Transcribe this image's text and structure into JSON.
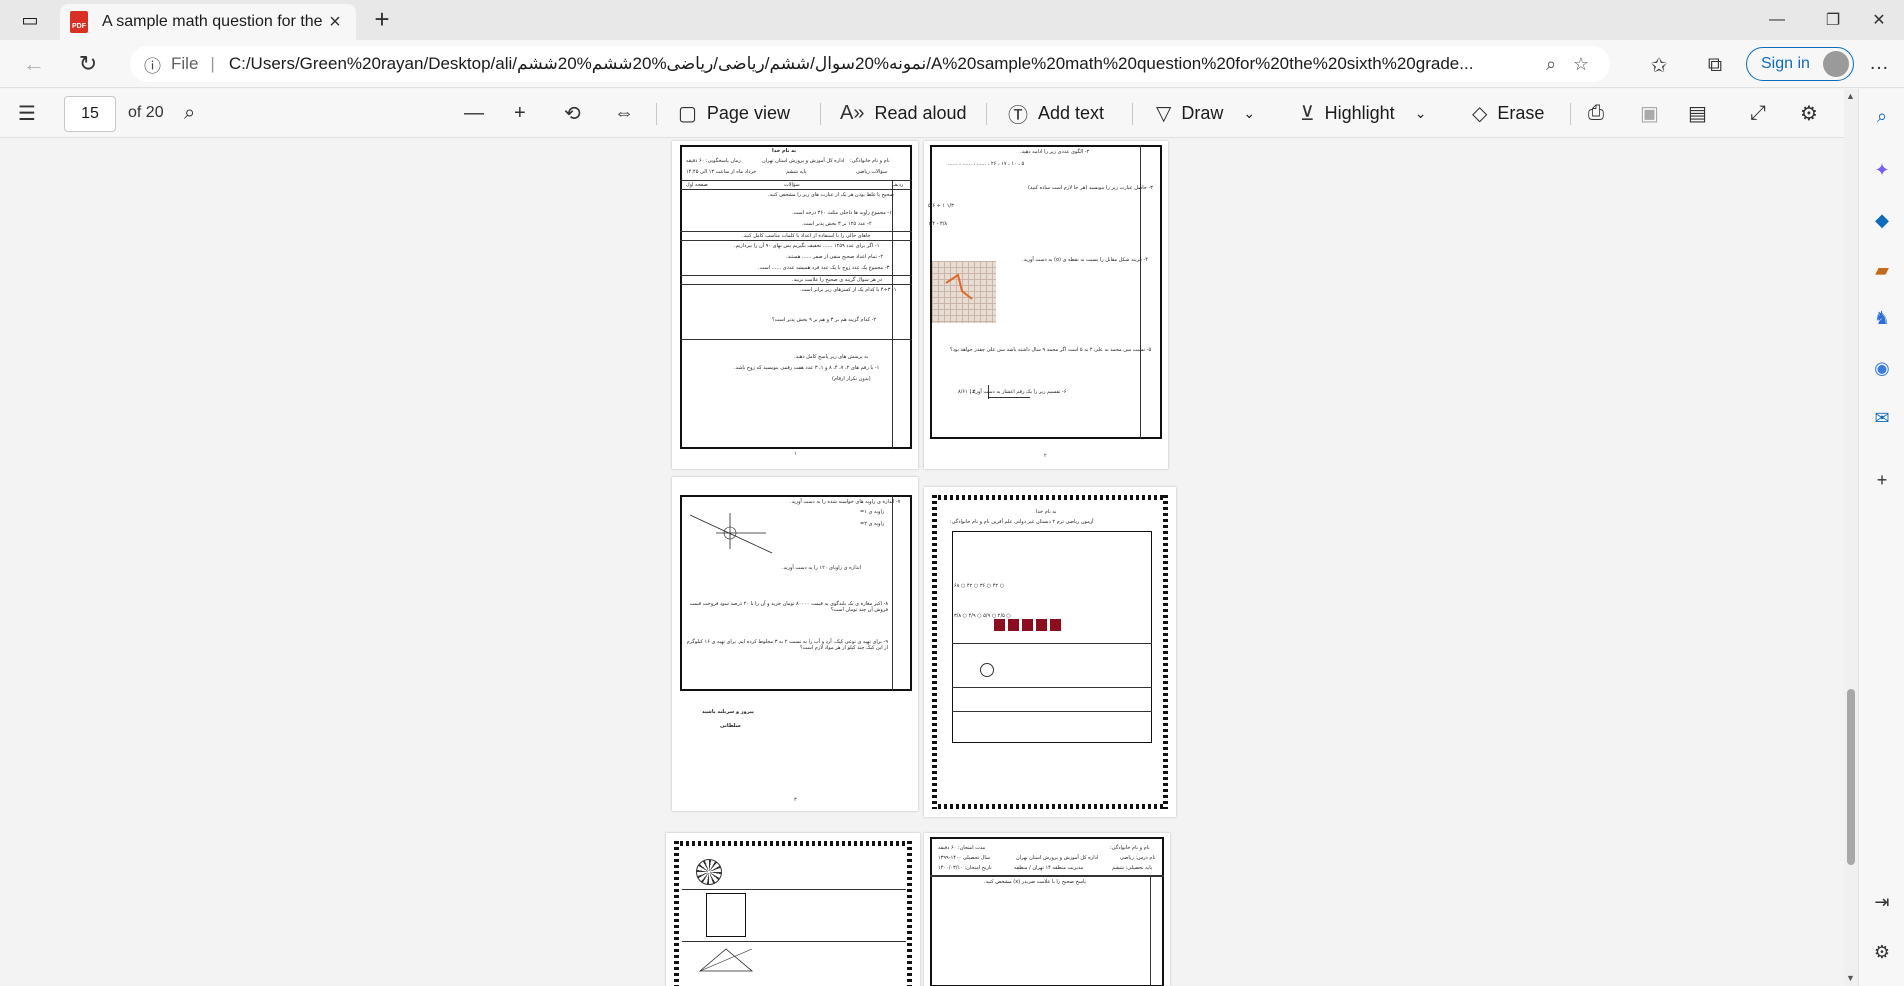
{
  "browser": {
    "tab": {
      "title": "A sample math question for the sixth grade"
    },
    "address": {
      "info_label": "File",
      "url": "C:/Users/Green%20rayan/Desktop/ali/نمونه%20سوال/ششم/ریاضی/ریاضی%20ششم%20ششم/A%20sample%20math%20question%20for%20the%20sixth%20grade..."
    },
    "signin_label": "Sign in"
  },
  "pdf_toolbar": {
    "page_number": "15",
    "page_total": "of 20",
    "page_view_label": "Page view",
    "read_aloud_label": "Read aloud",
    "add_text_label": "Add text",
    "draw_label": "Draw",
    "highlight_label": "Highlight",
    "erase_label": "Erase"
  },
  "pages": {
    "p1": {
      "header_basmala": "به نام خدا",
      "name_label": "نام و نام خانوادگی:",
      "org": "اداره کل آموزش و پرورش استان تهران",
      "duration": "زمان پاسخگویی: ۶۰ دقیقه",
      "subject": "سؤالات ریاضی",
      "grade": "پایه ششم",
      "date": "خرداد ماه از ساعت ۱۳ الی ۱۴:۴۵",
      "col_row": "ردیف",
      "col_questions": "سؤالات",
      "page_label": "صفحه اول",
      "q_a": "صحیح یا غلط بودن هر یک از عبارت های زیر را مشخص کنید.",
      "q_a1": "۱- مجموع زاویه ها داخلی مثلث ۳۶۰ درجه است.",
      "q_a2": "۲- عدد ۱۲۵ بر ۳ بخش پذیر است.",
      "q_b": "جاهای خالی را با استفاده از اعداد یا کلمات مناسب کامل کنید.",
      "q_b1": "۱- اگر برای عدد ۱۲۵۹ ...... تخفیف بگیریم پس بهای ۹۰ آن را بپردازیم.",
      "q_b2": "۲- تمام اعداد صحیح منفی از صفر ...... هستند.",
      "q_b3": "۳- مجموع یک عدد زوج با یک عدد فرد همیشه عددی ...... است.",
      "q_c": "در هر سوال گزینه ی صحیح را علامت بزنید.",
      "q_c1": "۱- ۳÷۴ با کدام یک از کسرهای زیر برابر است.",
      "q_c2": "۲- کدام گزینه هم بر ۳ و هم بر ۹ بخش پذیر است؟",
      "q_d": "به پرسش های زیر پاسخ کامل دهید.",
      "q_d1": "۱- با رقم های ۲، ۷، ۴، ۸ و ۱، ۳ عدد هفت رقمی بنویسید که زوج باشد.",
      "q_d1b": "(بدون تکرار ارقام)",
      "num": "۱"
    },
    "p2": {
      "q1": "۲- الگوی عددی زیر را ادامه دهید.",
      "q1_values": "۵ ، ۱۰ ، ۱۷ ، ۲۶ ، ...... ، ...... ، ......",
      "q2": "۳- حاصل عبارت زیر را بنویسید (هر جا لازم است ساده کنید)",
      "q3": "۴- قرینه شکل مقابل را نسبت به نقطه ی (o) به دست آورید.",
      "q4": "۵- نسبت سن محمد به علی ۴ به ۵ است اگر محمد ۹ سال داشته باشد سن علی چقدر خواهد بود؟",
      "q5": "۶- تقسیم زیر را یک رقم اعشار به دست آورید.",
      "division": "۸/۶۱ | ۳",
      "num": "۲"
    },
    "p3": {
      "q1": "۷- اندازه ی زاویه های خواسته شده را به دست آورید.",
      "angle1": "زاویه ی ۱=",
      "angle2": "زاویه ی ۲=",
      "q2": "اندازه ی زاویای ۱۲۰ را به دست آورید.",
      "q3": "۸- اکبر مغازه ی یک بلندگوی به قیمت ۸۰۰۰۰ تومان خرید و آن را با ۲۰ درصد سود فروخت قیمت فروش آن چند تومان است؟",
      "q4": "۹- برای تهیه ی نوعی کیک، آرد و آب را به نسبت ۲ به ۳ مخلوط کرده ایم. برای تهیه ی ۱۶ کیلوگرم از این کیک چند کیلو از هر مواد لازم است؟",
      "closing1": "پیروز و سربلند باشید",
      "closing2": "سلطانی",
      "num": "۳"
    },
    "p4": {
      "basmala": "به نام خدا",
      "title": "آزمون ریاضی ترم ۲    دبستان غیر دولتی علم آفرین    نام و نام خانوادگی:",
      "options": "۶۸ ○    ۴۲ ○    ۳۶ ○    ۴۲ ○",
      "fractions": "۳/۸ ○  ۴/۹ ○  ۵/۹ ○  ۲/۵ ○"
    },
    "p5": {
      "name_label": "نام و نام خانوادگی:",
      "subject": "نام درس: ریاضی",
      "grade": "پایه تحصیلی: ششم",
      "org": "اداره کل آموزش و پرورش استان تهران",
      "school": "مدیریت منطقه ۱۴ تهران / منطقه",
      "duration": "مدت امتحان: ۶۰ دقیقه",
      "year": "سال تحصیلی ۱۴۰۰-۱۳۹۹",
      "date": "تاریخ امتحان: ۱۴۰۰/۰۳/۱۰",
      "instruction": "پاسخ صحیح را با علامت ضربدر (x) مشخص کنید."
    }
  }
}
